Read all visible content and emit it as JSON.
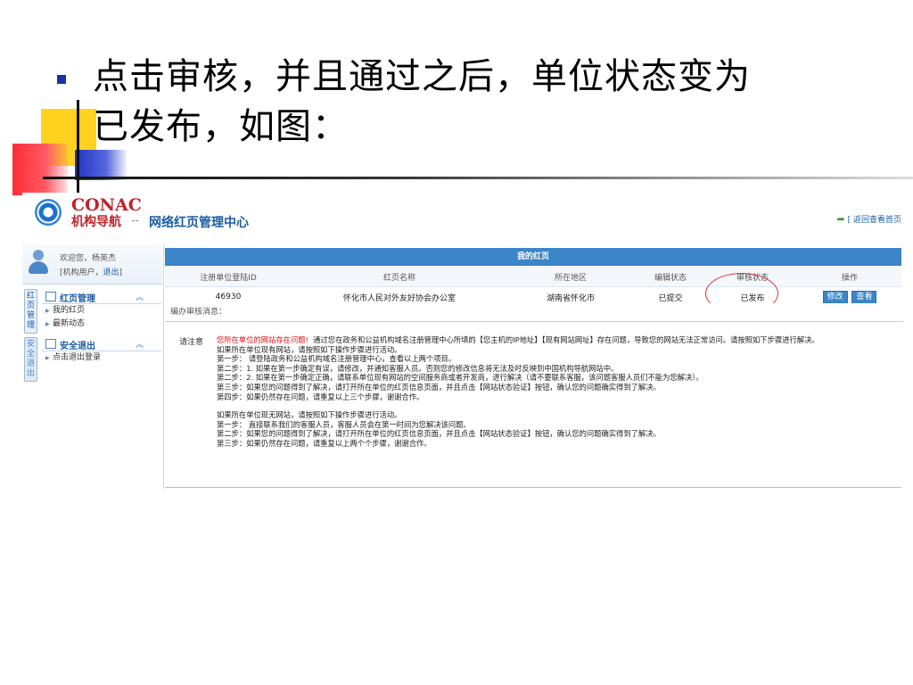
{
  "slide": {
    "text_line1": "点击审核，并且通过之后，单位状态变为",
    "text_line2": "已发布，如图："
  },
  "header": {
    "logo_main": "CONAC",
    "logo_sub": "机构导航",
    "separator": "--",
    "title": "网络红页管理中心",
    "return_link": "[ 返回查看首页"
  },
  "user": {
    "welcome": "欢迎您，杨英杰",
    "role_prefix": "[机构用户，",
    "logout": "退出",
    "role_suffix": "]"
  },
  "vtabs": [
    "红页管理",
    "安全退出"
  ],
  "menu": [
    {
      "title": "红页管理",
      "items": [
        "我的红页",
        "最新动态"
      ]
    },
    {
      "title": "安全退出",
      "items": [
        "点击退出登录"
      ]
    }
  ],
  "grid": {
    "title": "我的红页",
    "columns": [
      "注册单位登陆ID",
      "红页名称",
      "所在地区",
      "编辑状态",
      "审核状态",
      "操作"
    ],
    "rows": [
      {
        "id": "46930",
        "name": "怀化市人民对外友好协会办公室",
        "region": "湖南省怀化市",
        "edit_status": "已提交",
        "review_status": "已发布",
        "actions": [
          "修改",
          "查看"
        ]
      }
    ]
  },
  "message_label": "编办审核消息：",
  "notice": {
    "label": "请注意",
    "headline": "您所在单位的网站存在问题!",
    "intro": "通过您在政务和公益机构域名注册管理中心所填的【您主机的IP地址】【现有网站网址】存在问题，导致您的网站无法正常访问。请按照如下步骤进行解决。",
    "lines": [
      "如果所在单位现有网站，请按照如下操作步骤进行活动。",
      "第一步： 请登陆政务和公益机构域名注册管理中心，查看以上两个项目。",
      "第二步：1. 如果在第一步确定有误，请修改，并通知客服人员。否则您的修改信息将无法及时反映到中国机构导航网站中。",
      "第二步：2. 如果在第一步确定正确，请联系单位现有网站的空间服务商或者开发商，进行解决（请不要联系客服，该问题客服人员们不能为您解决）。",
      "第三步：如果您的问题得到了解决，请打开所在单位的红页信息页面，并且点击【网站状态验证】按钮，确认您的问题确实得到了解决。",
      "第四步：如果仍然存在问题，请重复以上三个步骤，谢谢合作。",
      "",
      "如果所在单位现无网站，请按照如下操作步骤进行活动。",
      "第一步： 直接联系我们的客服人员，客服人员会在第一时间为您解决该问题。",
      "第二步：如果您的问题得到了解决，请打开所在单位的红页信息页面，并且点击【网站状态验证】按钮，确认您的问题确实得到了解决。",
      "第三步：如果仍然存在问题，请重复以上两个个步骤，谢谢合作。"
    ]
  },
  "colors": {
    "accent": "#3b85c8",
    "brand_red": "#c0242c",
    "bullet": "#1a2fa8"
  }
}
